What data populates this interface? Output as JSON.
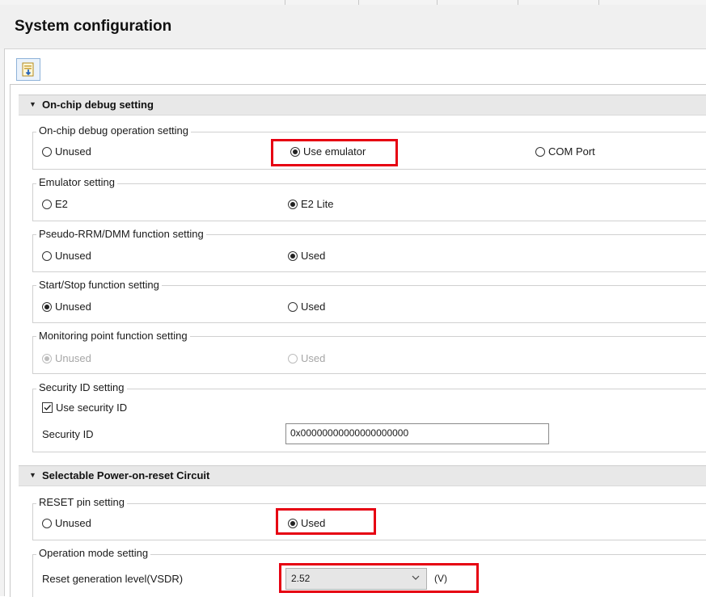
{
  "page": {
    "title": "System configuration"
  },
  "colors": {
    "highlight": "#e60012",
    "section_bg": "#e8e8e8",
    "header_bg": "#f0f0f0"
  },
  "toolbar": {
    "icon": "document-import-icon"
  },
  "sections": {
    "onchip": {
      "label": "On-chip debug setting",
      "operation": {
        "legend": "On-chip debug operation setting",
        "options": [
          "Unused",
          "Use emulator",
          "COM Port"
        ],
        "selected": "Use emulator"
      },
      "emulator": {
        "legend": "Emulator setting",
        "options": [
          "E2",
          "E2 Lite"
        ],
        "selected": "E2 Lite"
      },
      "pseudo_rrm": {
        "legend": "Pseudo-RRM/DMM function setting",
        "options": [
          "Unused",
          "Used"
        ],
        "selected": "Used"
      },
      "start_stop": {
        "legend": "Start/Stop function setting",
        "options": [
          "Unused",
          "Used"
        ],
        "selected": "Unused"
      },
      "monitoring": {
        "legend": "Monitoring point function setting",
        "options": [
          "Unused",
          "Used"
        ],
        "selected": "Unused",
        "disabled": true
      },
      "security": {
        "legend": "Security ID setting",
        "checkbox_label": "Use security ID",
        "checked": true,
        "id_label": "Security ID",
        "id_value": "0x00000000000000000000"
      }
    },
    "por": {
      "label": "Selectable Power-on-reset Circuit",
      "reset_pin": {
        "legend": "RESET pin setting",
        "options": [
          "Unused",
          "Used"
        ],
        "selected": "Used"
      },
      "operation_mode": {
        "legend": "Operation mode setting",
        "level_label": "Reset generation level(VSDR)",
        "level_value": "2.52",
        "unit": "(V)"
      }
    }
  }
}
